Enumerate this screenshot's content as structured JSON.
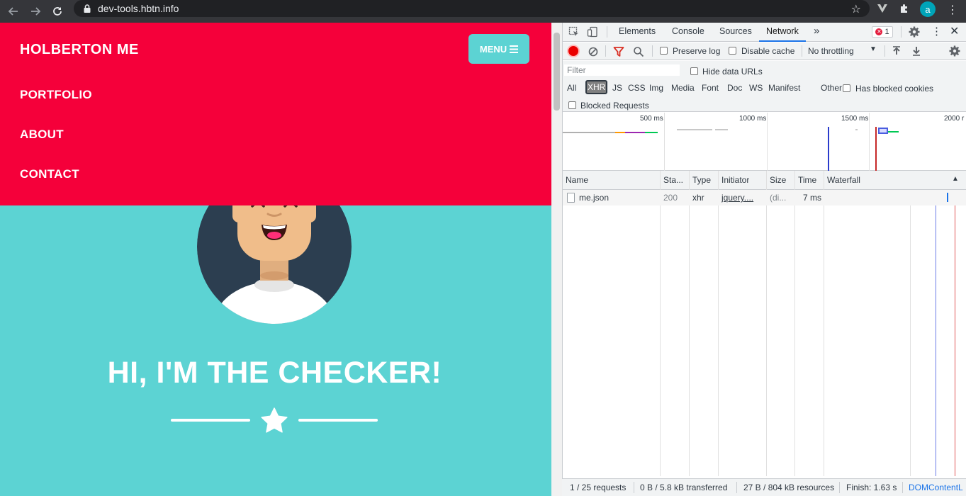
{
  "browser": {
    "url": "dev-tools.hbtn.info",
    "profile_initial": "a",
    "colors": {
      "chrome_bg": "#35363a",
      "omnibox_bg": "#202124"
    }
  },
  "page": {
    "brand": "HOLBERTON ME",
    "menu_button": "MENU",
    "nav_links": [
      "PORTFOLIO",
      "ABOUT",
      "CONTACT"
    ],
    "hero_title": "HI, I'M THE CHECKER!",
    "colors": {
      "navbar": "#f5003a",
      "hero_bg": "#5cd3d3",
      "avatar_bg": "#2c3e50"
    }
  },
  "devtools": {
    "tabs": [
      "Elements",
      "Console",
      "Sources",
      "Network"
    ],
    "active_tab": "Network",
    "more_tabs": "»",
    "error_count": "1",
    "toolbar": {
      "preserve_log": "Preserve log",
      "disable_cache": "Disable cache",
      "throttling": "No throttling"
    },
    "filter": {
      "placeholder": "Filter",
      "hide_data_urls": "Hide data URLs",
      "types": [
        "All",
        "XHR",
        "JS",
        "CSS",
        "Img",
        "Media",
        "Font",
        "Doc",
        "WS",
        "Manifest",
        "Other"
      ],
      "selected_type": "XHR",
      "has_blocked_cookies": "Has blocked cookies",
      "blocked_requests": "Blocked Requests"
    },
    "overview": {
      "tick_labels": [
        "500 ms",
        "1000 ms",
        "1500 ms",
        "2000 r"
      ]
    },
    "table": {
      "columns": [
        "Name",
        "Sta...",
        "Type",
        "Initiator",
        "Size",
        "Time",
        "Waterfall"
      ],
      "rows": [
        {
          "name": "me.json",
          "status": "200",
          "type": "xhr",
          "initiator": "jquery....",
          "size": "(di...",
          "time": "7 ms"
        }
      ]
    },
    "status_bar": {
      "requests": "1 / 25 requests",
      "transferred": "0 B / 5.8 kB transferred",
      "resources": "27 B / 804 kB resources",
      "finish": "Finish: 1.63 s",
      "dom_content": "DOMContentL"
    }
  }
}
